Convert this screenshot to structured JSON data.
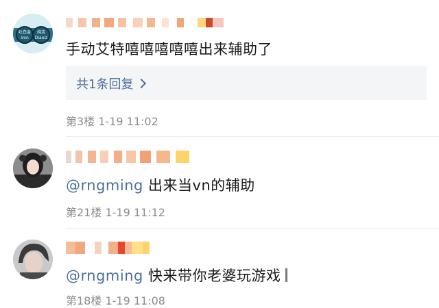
{
  "comments": [
    {
      "text": "手动艾特嘻嘻嘻嘻嘻出来辅助了",
      "reply_label": "共1条回复",
      "meta": "第3楼  1-19 11:02",
      "avatar_lines": [
        "吐白金",
        "Iron",
        "纯洁",
        "Diaoiz"
      ]
    },
    {
      "mention": "@rngming",
      "text": "出来当vn的辅助",
      "meta": "第21楼  1-19 11:12"
    },
    {
      "mention": "@rngming",
      "text": "快来带你老婆玩游戏",
      "meta": "第18楼  1-19 11:08"
    }
  ],
  "colors": {
    "link": "#4a6f9d",
    "meta": "#8c8c8c",
    "reply_bg": "#f4f5f7"
  },
  "icons": {
    "reply_arrow": "chevron-right-icon"
  }
}
